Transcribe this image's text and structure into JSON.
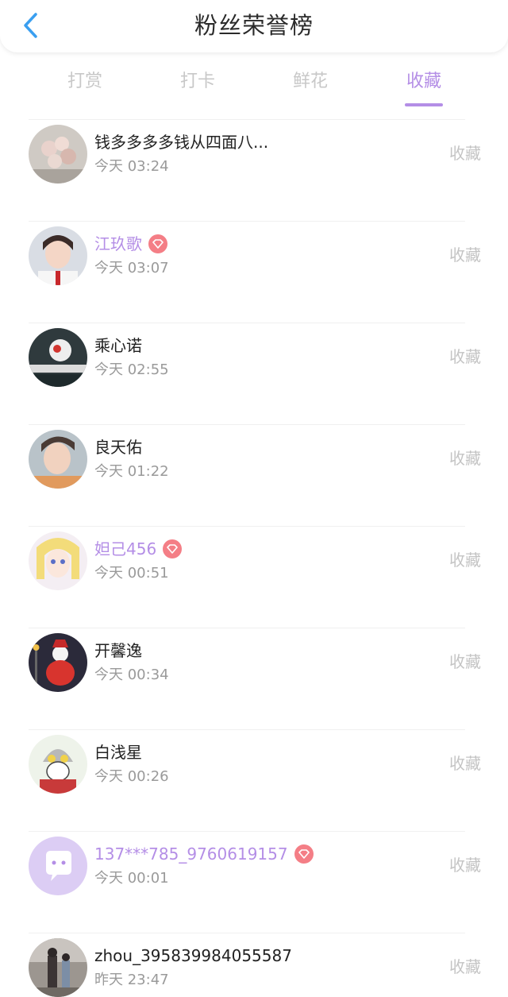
{
  "header": {
    "title": "粉丝荣誉榜",
    "back_icon": "chevron-left-icon"
  },
  "tabs": [
    {
      "label": "打赏"
    },
    {
      "label": "打卡"
    },
    {
      "label": "鲜花"
    },
    {
      "label": "收藏",
      "active": true
    }
  ],
  "colors": {
    "accent": "#b48ee6",
    "badge": "#f47e86",
    "back_arrow": "#3a9ff0"
  },
  "rows": [
    {
      "name": "钱多多多多钱从四面八...",
      "time": "今天 03:24",
      "action": "收藏",
      "vip": false,
      "avatar": "flower-bouquet"
    },
    {
      "name": "江玖歌",
      "time": "今天 03:07",
      "action": "收藏",
      "vip": true,
      "avatar": "girl-uniform"
    },
    {
      "name": "乘心诺",
      "time": "今天 02:55",
      "action": "收藏",
      "vip": false,
      "avatar": "dark-character"
    },
    {
      "name": "良天佑",
      "time": "今天 01:22",
      "action": "收藏",
      "vip": false,
      "avatar": "boy-portrait"
    },
    {
      "name": "妲己456",
      "time": "今天 00:51",
      "action": "收藏",
      "vip": true,
      "avatar": "anime-girl"
    },
    {
      "name": "开馨逸",
      "time": "今天 00:34",
      "action": "收藏",
      "vip": false,
      "avatar": "snowman"
    },
    {
      "name": "白浅星",
      "time": "今天 00:26",
      "action": "收藏",
      "vip": false,
      "avatar": "ultraman-cartoon"
    },
    {
      "name": "137***785_9760619157",
      "time": "今天 00:01",
      "action": "收藏",
      "vip": true,
      "avatar": "default-chat"
    },
    {
      "name": "zhou_395839984055587",
      "time": "昨天 23:47",
      "action": "收藏",
      "vip": false,
      "avatar": "street-photo"
    }
  ]
}
